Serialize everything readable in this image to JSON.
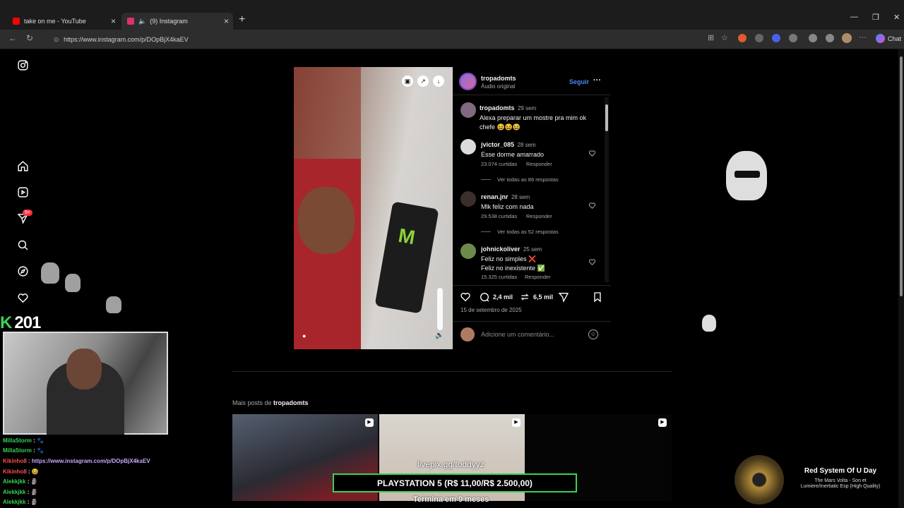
{
  "browser": {
    "tabs": [
      {
        "label": "take on me - YouTube",
        "favicon_color": "#ff0000"
      },
      {
        "label": "(9) Instagram",
        "favicon_color": "#e1306c"
      }
    ],
    "new_tab": "+",
    "url": "https://www.instagram.com/p/DOpBjX4kaEV",
    "chat_label": "Chat"
  },
  "sidebar": {
    "notification_badge": "9+",
    "icons": [
      "instagram-logo-icon",
      "home-icon",
      "reels-icon",
      "send-icon",
      "search-icon",
      "explore-icon",
      "heart-icon"
    ]
  },
  "post": {
    "author": "tropadomts",
    "audio": "Áudio original",
    "follow": "Seguir",
    "more": "···",
    "caption": {
      "user": "tropadomts",
      "time": "29 sem",
      "text": "Alexa preparar um mostre  pra mim ok chefe 😆😆😆"
    },
    "comments": [
      {
        "user": "jvictor_085",
        "time": "28 sem",
        "text": "Esse dorme amarrado",
        "likes": "23.074 curtidas",
        "reply": "Responder",
        "view_replies": "Ver todas as 86 respostas"
      },
      {
        "user": "renan.jnr",
        "time": "28 sem",
        "text": "Mlk feliz com nada",
        "likes": "29.538 curtidas",
        "reply": "Responder",
        "view_replies": "Ver todas as 52 respostas"
      },
      {
        "user": "johnickoliver",
        "time": "25 sem",
        "text_lines": [
          "Feliz no simples ❌",
          "Feliz no inexistente ✅"
        ],
        "likes": "15.325 curtidas",
        "reply": "Responder"
      }
    ],
    "comment_count": "2,4 mil",
    "repost_count": "6,5 mil",
    "date": "15 de setembro de 2025",
    "add_comment_placeholder": "Adicione um comentário..."
  },
  "more_posts": {
    "prefix": "Mais posts de",
    "user": "tropadomts"
  },
  "overlay": {
    "counter": "201",
    "chat": [
      {
        "user": "MillaStorm",
        "text": " : 🐾",
        "color": "#39d353"
      },
      {
        "user": "MillaStorm",
        "text": " : 🐾",
        "color": "#39d353"
      },
      {
        "user": "Kikinho8",
        "text": " : https://www.instagram.com/p/DOpBjX4kaEV",
        "color": "#ff4d4d"
      },
      {
        "user": "Kikinho8",
        "text": " : 😆",
        "color": "#ff4d4d"
      },
      {
        "user": "Alekkjkk",
        "text": " : 🗿",
        "color": "#39d353"
      },
      {
        "user": "Alekkjkk",
        "text": " : 🗿",
        "color": "#39d353"
      },
      {
        "user": "Alekkjkk",
        "text": " : 🗿",
        "color": "#39d353"
      }
    ],
    "livepix": "livepix.gg/toddyyz",
    "goal": "PLAYSTATION 5 (R$ 11,00/R$ 2.500,00)",
    "goal_ends": "Termina em 9 meses",
    "now_playing": {
      "title": "Red System Of U Day",
      "subtitle_1": "The Mars Volta - Son et",
      "subtitle_2": "Lumiere/Inertiatic Esp (High Quality)"
    }
  }
}
